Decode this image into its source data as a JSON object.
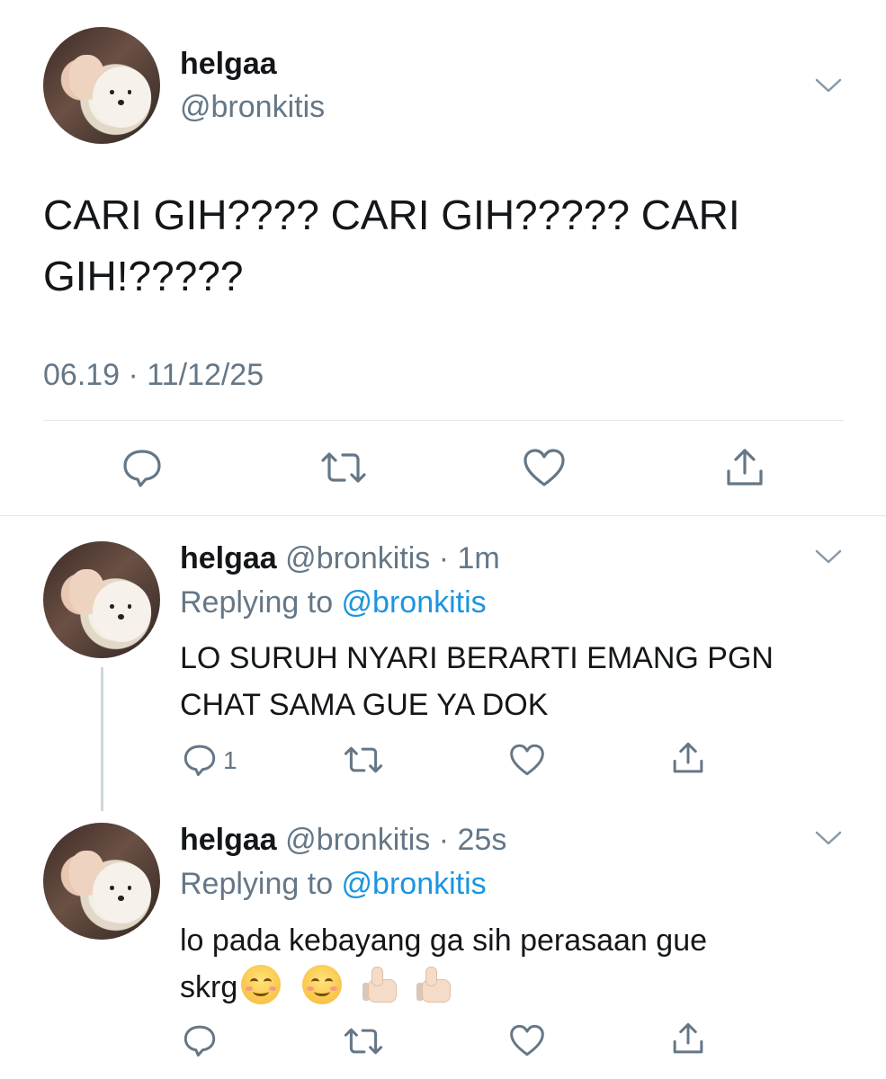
{
  "main_tweet": {
    "display_name": "helgaa",
    "handle": "@bronkitis",
    "text_line1": "CARI GIH???? CARI GIH????? CARI",
    "text_line2": "GIH!?????",
    "timestamp": "06.19 · 11/12/25",
    "actions": [
      "reply-icon",
      "retweet-icon",
      "like-icon",
      "share-icon"
    ]
  },
  "replies": [
    {
      "display_name": "helgaa",
      "handle": "@bronkitis",
      "separator": " · ",
      "time": "1m",
      "replying_prefix": "Replying to ",
      "replying_to": "@bronkitis",
      "text_line1": "LO SURUH NYARI BERARTI EMANG PGN",
      "text_line2": "CHAT SAMA GUE YA DOK",
      "reply_count": "1"
    },
    {
      "display_name": "helgaa",
      "handle": "@bronkitis",
      "separator": " · ",
      "time": "25s",
      "replying_prefix": "Replying to ",
      "replying_to": "@bronkitis",
      "text_line1": "lo pada kebayang ga sih perasaan gue",
      "text_line2": "skrg",
      "emojis": [
        "smiling-face-emoji",
        "smiling-face-emoji",
        "thumbs-up-emoji",
        "thumbs-up-emoji"
      ]
    }
  ],
  "colors": {
    "text": "#14171a",
    "secondary": "#657786",
    "link": "#1b95e0",
    "icon": "#657786",
    "divider": "#e1e8ed",
    "thread_line": "#ccd6dd"
  }
}
